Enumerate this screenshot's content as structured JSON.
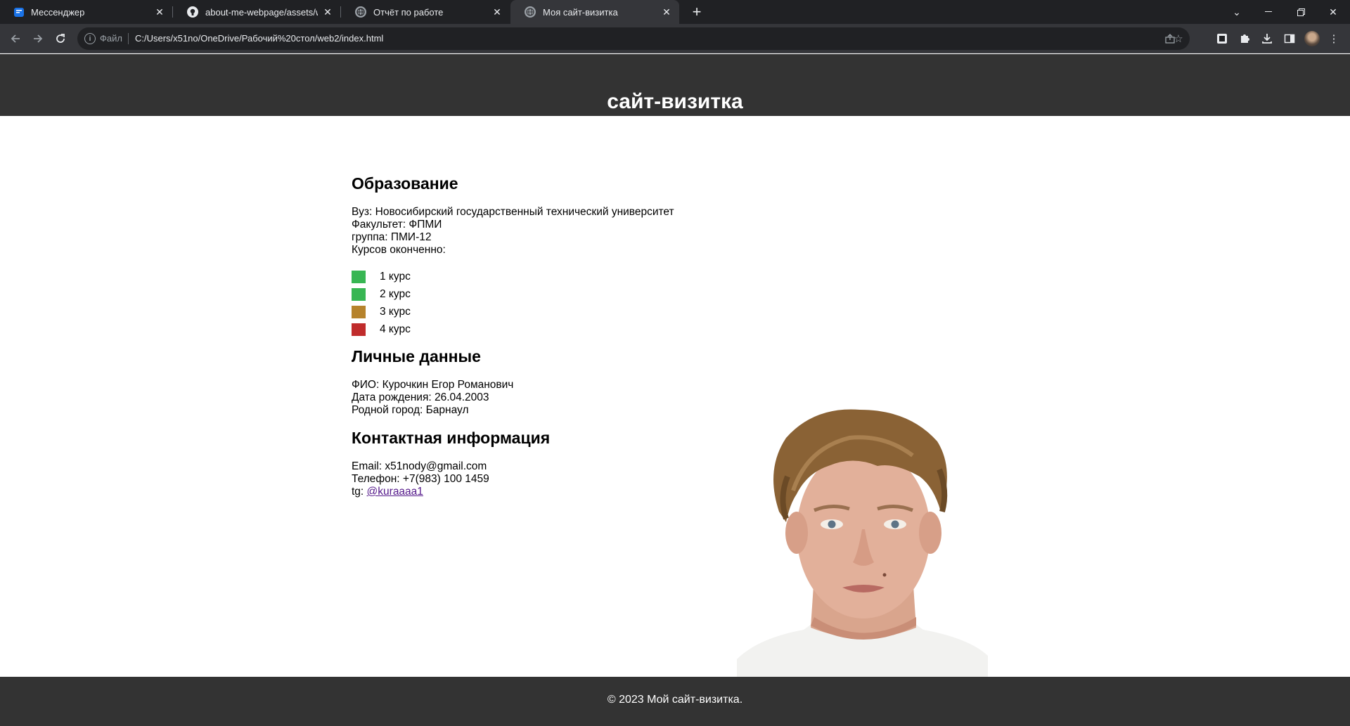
{
  "browser": {
    "tabs": [
      {
        "title": "Мессенджер",
        "icon": "chat-icon"
      },
      {
        "title": "about-me-webpage/assets/wallpaper",
        "icon": "github-icon"
      },
      {
        "title": "Отчёт по работе",
        "icon": "globe-icon"
      },
      {
        "title": "Моя сайт-визитка",
        "icon": "globe-icon"
      }
    ],
    "address": {
      "scheme_label": "Файл",
      "url": "C:/Users/x51no/OneDrive/Рабочий%20стол/web2/index.html"
    }
  },
  "page": {
    "title": "сайт-визитка",
    "education": {
      "heading": "Образование",
      "lines": [
        "Вуз: Новосибирский государственный технический университет",
        "Факультет: ФПМИ",
        "группа: ПМИ-12",
        "Курсов оконченно:"
      ],
      "courses": [
        {
          "label": "1 курс",
          "color": "#38b653"
        },
        {
          "label": "2 курс",
          "color": "#38b653"
        },
        {
          "label": "3 курс",
          "color": "#b6832c"
        },
        {
          "label": "4 курс",
          "color": "#c02c2c"
        }
      ]
    },
    "personal": {
      "heading": "Личные данные",
      "lines": [
        "ФИО: Курочкин Егор Романович",
        "Дата рождения: 26.04.2003",
        "Родной город: Барнаул"
      ]
    },
    "contacts": {
      "heading": "Контактная информация",
      "email": "Email: x51nody@gmail.com",
      "phone": "Телефон: +7(983) 100 1459",
      "tg_prefix": "tg: ",
      "tg_link": "@kuraaaa1"
    },
    "footer": "© 2023 Мой сайт-визитка."
  }
}
